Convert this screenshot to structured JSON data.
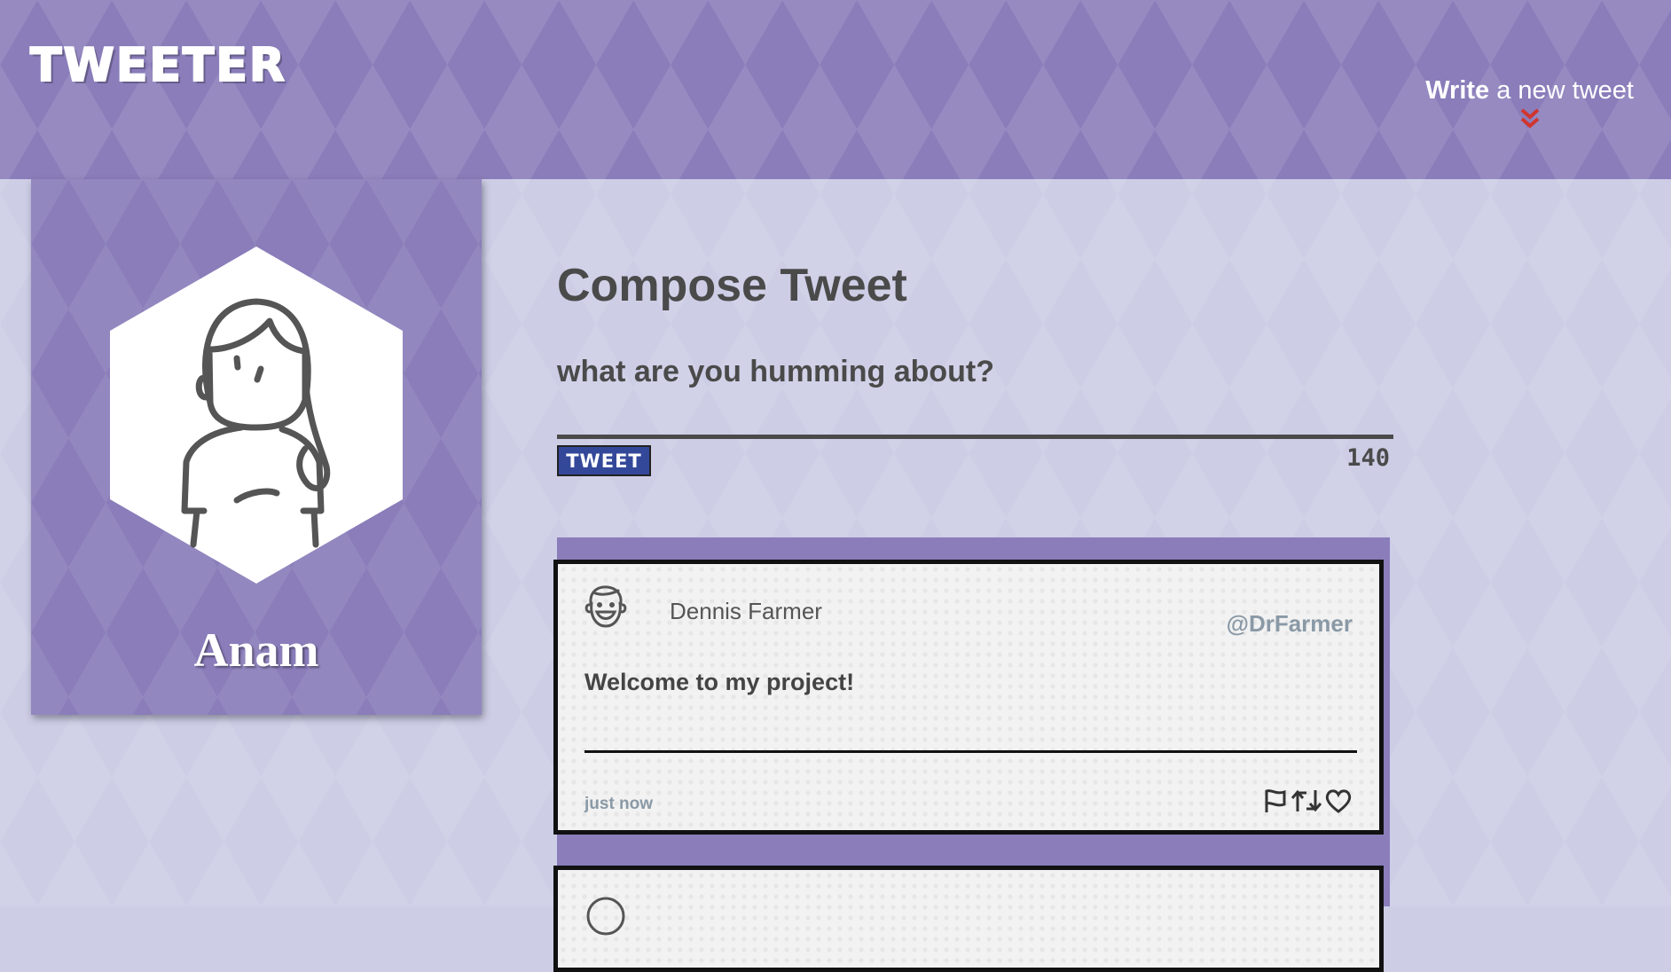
{
  "nav": {
    "brand": "TWEETER",
    "compose_toggle": {
      "strong": "Write",
      "rest": " a new tweet"
    }
  },
  "profile": {
    "name": "Anam"
  },
  "compose": {
    "title": "Compose Tweet",
    "prompt": "what are you humming about?",
    "button_label": "TWEET",
    "counter": "140"
  },
  "tweets": [
    {
      "name": "Dennis Farmer",
      "handle": "@DrFarmer",
      "body": "Welcome to my project!",
      "time": "just now",
      "actions": [
        "flag-icon",
        "retweet-icon",
        "heart-icon"
      ]
    }
  ],
  "colors": {
    "nav": "#8a7dba",
    "page_bg": "#cdcde6",
    "tweet_button": "#34489a",
    "chevron": "#d0352f",
    "muted": "#8a99a6"
  }
}
